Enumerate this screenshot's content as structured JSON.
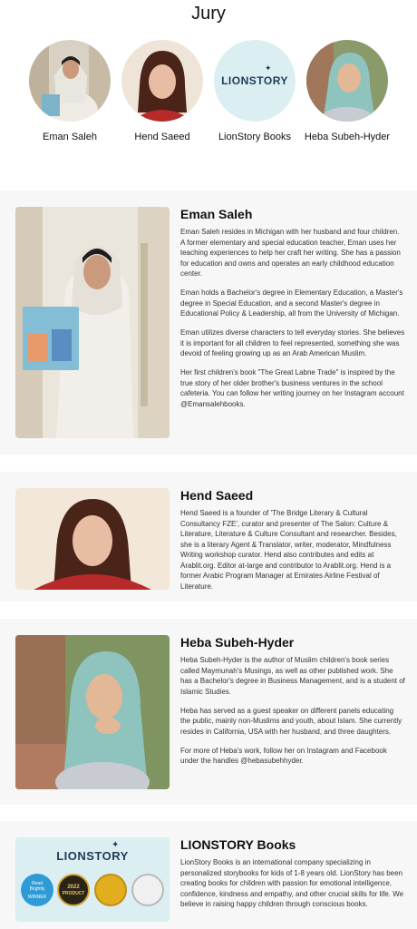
{
  "page": {
    "title": "Jury"
  },
  "jury": [
    {
      "name": "Eman Saleh"
    },
    {
      "name": "Hend Saeed"
    },
    {
      "name": "LionStory Books"
    },
    {
      "name": "Heba Subeh-Hyder"
    }
  ],
  "logo": {
    "text": "LIONSTORY"
  },
  "profiles": [
    {
      "name": "Eman Saleh",
      "paragraphs": [
        "Eman Saleh resides in Michigan with her husband and four children. A former elementary and special education teacher, Eman uses her teaching experiences to help her craft her writing. She has a passion for education and owns and operates an early childhood education center.",
        "Eman holds a Bachelor's degree in Elementary Education, a Master's degree in Special Education, and a second Master's degree in Educational Policy & Leadership, all from the University of Michigan.",
        "Eman utilizes diverse characters to tell everyday stories. She believes it is important for all children to feel represented, something she was devoid of feeling growing up as an Arab American Muslim.",
        "Her first children's book \"The Great Labne Trade\" is inspired by the true story of her older brother's business ventures in the school cafeteria. You can follow her writing journey on her Instagram account @Emansalehbooks."
      ]
    },
    {
      "name": "Hend Saeed",
      "paragraphs": [
        "Hend Saeed is a founder of 'The Bridge Literary & Cultural Consultancy FZE', curator and presenter of The Salon: Culture & Literature, Literature & Culture Consultant and researcher. Besides, she is a literary Agent & Translator, writer, moderator, Mindfulness Writing workshop curator. Hend also contributes and edits at Arablit.org. Editor at-large and contributor to Arablit.org. Hend is a former Arabic Program Manager at Emirates Airline Festival of Literature."
      ]
    },
    {
      "name": "Heba Subeh-Hyder",
      "paragraphs": [
        "Heba Subeh-Hyder is the author of Muslim children's book series called Maymunah's Musings, as well as other published work. She has a Bachelor's degree in Business Management, and is a student of Islamic Studies.",
        "Heba has served as a guest speaker on different panels educating the public, mainly non-Muslims and youth, about Islam. She currently resides in California, USA with her husband, and three daughters.",
        "For more of Heba's work, follow her on Instagram and Facebook under the handles @hebasubehhyder."
      ]
    },
    {
      "name": "LIONSTORY Books",
      "paragraphs": [
        "LionStory Books is an international company specializing in personalized storybooks for kids of 1-8 years old. LionStory has been creating books for children with passion for emotional intelligence, confidence, kindness and empathy, and other crucial skills for life. We believe in raising happy children through conscious books."
      ]
    }
  ],
  "badges": [
    {
      "line1": "Read",
      "line2": "Brightly",
      "line3": "WINNER"
    },
    {
      "line1": "2022",
      "line2": "PRODUCT",
      "line3": ""
    },
    {
      "line1": "",
      "line2": "",
      "line3": ""
    },
    {
      "line1": "",
      "line2": "",
      "line3": ""
    }
  ]
}
